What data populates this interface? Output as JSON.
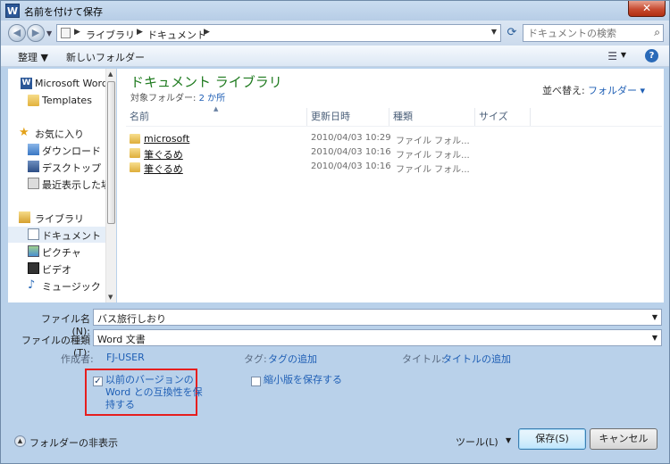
{
  "window": {
    "title": "名前を付けて保存",
    "close": "✕"
  },
  "address": {
    "crumbs": [
      "ライブラリ",
      "ドキュメント"
    ],
    "search_placeholder": "ドキュメントの検索"
  },
  "toolbar": {
    "organize": "整理 ▼",
    "new_folder": "新しいフォルダー",
    "help": "?"
  },
  "nav": {
    "items": [
      {
        "label": "Microsoft Word"
      },
      {
        "label": "Templates"
      },
      {
        "label": "お気に入り"
      },
      {
        "label": "ダウンロード"
      },
      {
        "label": "デスクトップ"
      },
      {
        "label": "最近表示した場所"
      },
      {
        "label": "ライブラリ"
      },
      {
        "label": "ドキュメント"
      },
      {
        "label": "ピクチャ"
      },
      {
        "label": "ビデオ"
      },
      {
        "label": "ミュージック"
      }
    ]
  },
  "content": {
    "title": "ドキュメント ライブラリ",
    "subtitle_label": "対象フォルダー: ",
    "subtitle_link": "2 か所",
    "sort_label": "並べ替え:",
    "sort_value": "フォルダー ▾",
    "columns": [
      "名前",
      "更新日時",
      "種類",
      "サイズ"
    ],
    "rows": [
      {
        "name": "microsoft",
        "date": "2010/04/03 10:29",
        "type": "ファイル フォル..."
      },
      {
        "name": "筆ぐるめ",
        "date": "2010/04/03 10:16",
        "type": "ファイル フォル..."
      },
      {
        "name": "筆ぐるめ",
        "date": "2010/04/03 10:16",
        "type": "ファイル フォル..."
      }
    ]
  },
  "form": {
    "filename_label": "ファイル名(N):",
    "filename_value": "バス旅行しおり",
    "filetype_label": "ファイルの種類(T):",
    "filetype_value": "Word 文書",
    "author_label": "作成者:",
    "author_value": "FJ-USER",
    "tags_label": "タグ:",
    "tags_value": "タグの追加",
    "title_label": "タイトル:",
    "title_value": "タイトルの追加",
    "compat_lines": [
      "以前のバージョンの",
      "Word との互換性を保",
      "持する"
    ],
    "thumbnail_label": "縮小版を保存する"
  },
  "footer": {
    "hide_folders": "フォルダーの非表示",
    "tools": "ツール(L)",
    "save": "保存(S)",
    "cancel": "キャンセル"
  }
}
